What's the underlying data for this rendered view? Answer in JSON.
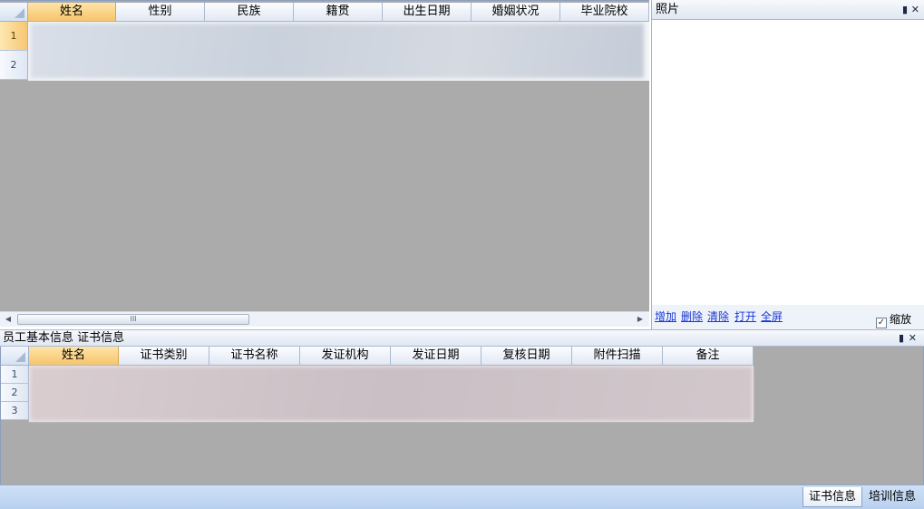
{
  "top_grid": {
    "columns": [
      "姓名",
      "性别",
      "民族",
      "籍贯",
      "出生日期",
      "婚姻状况",
      "毕业院校"
    ],
    "rows": [
      "1",
      "2"
    ]
  },
  "photo_panel": {
    "title": "照片",
    "actions": [
      "增加",
      "删除",
      "清除",
      "打开",
      "全屏"
    ],
    "zoom_label": "缩放",
    "zoom_checked": true
  },
  "dock": {
    "title": "员工基本信息 证书信息"
  },
  "bottom_grid": {
    "columns": [
      "姓名",
      "证书类别",
      "证书名称",
      "发证机构",
      "发证日期",
      "复核日期",
      "附件扫描",
      "备注"
    ],
    "rows": [
      "1",
      "2",
      "3"
    ]
  },
  "tabs": [
    "证书信息",
    "培训信息"
  ],
  "icons": {
    "pin": "pin-icon",
    "close": "close-icon",
    "scroll_left": "arrow-left-icon",
    "scroll_right": "arrow-right-icon"
  }
}
